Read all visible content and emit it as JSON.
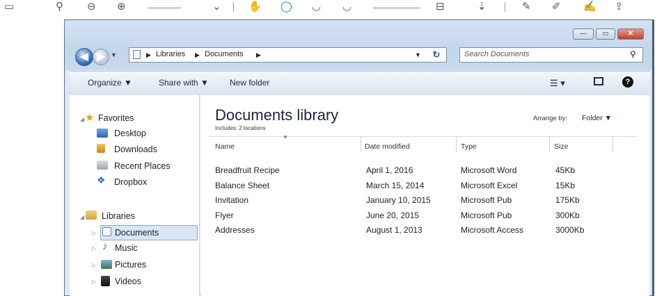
{
  "window": {
    "caption_min": "—",
    "caption_max": "▭",
    "caption_close": "✕"
  },
  "nav": {
    "breadcrumb": [
      "Libraries",
      "Documents"
    ],
    "search_placeholder": "Search Documents"
  },
  "commands": {
    "organize": "Organize ▼",
    "share_with": "Share with ▼",
    "new_folder": "New folder"
  },
  "sidebar": {
    "favorites_label": "Favorites",
    "favorites": [
      "Desktop",
      "Downloads",
      "Recent Places",
      "Dropbox"
    ],
    "libraries_label": "Libraries",
    "libraries": [
      "Documents",
      "Music",
      "Pictures",
      "Videos"
    ]
  },
  "library": {
    "title": "Documents library",
    "subtitle": "Includes: 2 locations",
    "arrange_label": "Arrange by:",
    "arrange_value": "Folder ▼"
  },
  "table": {
    "columns": [
      "Name",
      "Date modified",
      "Type",
      "Size"
    ],
    "rows": [
      [
        "Breadfruit Recipe",
        "April 1, 2016",
        "Microsoft Word",
        "45Kb"
      ],
      [
        "Balance Sheet",
        "March 15, 2014",
        "Microsoft Excel",
        "15Kb"
      ],
      [
        "Invitation",
        "January 10, 2015",
        "Microsoft Pub",
        "175Kb"
      ],
      [
        "Flyer",
        "June 20, 2015",
        "Microsoft Pub",
        "300Kb"
      ],
      [
        "Addresses",
        "August 1, 2013",
        "Microsoft Access",
        "3000Kb"
      ]
    ]
  },
  "colors": {
    "selection": "#d8e6f5",
    "frame": "#c3d6ea",
    "back_button": "#2d6cb4"
  }
}
